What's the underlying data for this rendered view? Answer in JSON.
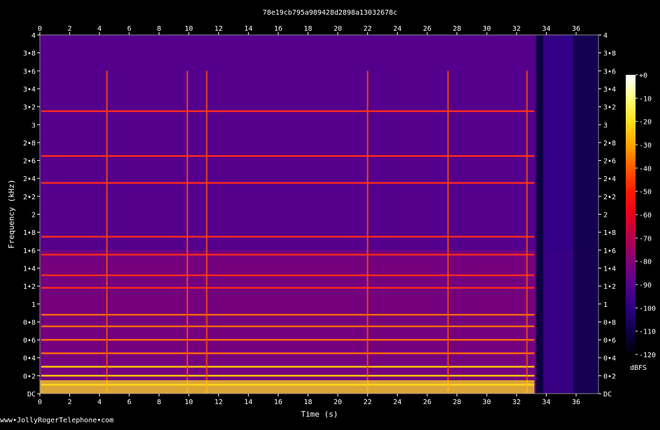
{
  "credit": "www•JollyRogerTelephone•com",
  "chart_data": {
    "type": "heatmap",
    "title": "78e19cb795a989428d2898a13032678c",
    "xlabel": "Time (s)",
    "ylabel": "Frequency (kHz)",
    "xlim": [
      0,
      37.5
    ],
    "ylim": [
      0,
      4
    ],
    "x_ticks": [
      "0",
      "2",
      "4",
      "6",
      "8",
      "10",
      "12",
      "14",
      "16",
      "18",
      "20",
      "22",
      "24",
      "26",
      "28",
      "30",
      "32",
      "34",
      "36"
    ],
    "y_ticks": [
      "DC",
      "0•2",
      "0•4",
      "0•6",
      "0•8",
      "1",
      "1•2",
      "1•4",
      "1•6",
      "1•8",
      "2",
      "2•2",
      "2•4",
      "2•6",
      "2•8",
      "3",
      "3•2",
      "3•4",
      "3•6",
      "3•8",
      "4"
    ],
    "colorbar": {
      "label": "dBFS",
      "range": [
        -120,
        0
      ],
      "ticks": [
        "+0",
        "-10",
        "-20",
        "-30",
        "-40",
        "-50",
        "-60",
        "-70",
        "-80",
        "-90",
        "-100",
        "-110",
        "-120"
      ],
      "colors": [
        "#ffffff",
        "#ffff80",
        "#ffdd20",
        "#ffa500",
        "#ff5a00",
        "#ff1a00",
        "#e6001e",
        "#b4004b",
        "#820078",
        "#55008c",
        "#2d0082",
        "#0f0046",
        "#000000"
      ]
    },
    "silence_regions_s": [
      [
        33.3,
        33.8
      ]
    ],
    "harmonic_lines_khz": [
      0.1,
      0.2,
      0.3,
      0.45,
      0.6,
      0.75,
      0.88,
      1.18,
      1.32,
      1.55,
      1.75,
      2.35,
      2.65,
      3.15
    ],
    "transients_s": [
      4.5,
      9.9,
      11.2,
      22.0,
      27.4,
      32.7
    ]
  }
}
